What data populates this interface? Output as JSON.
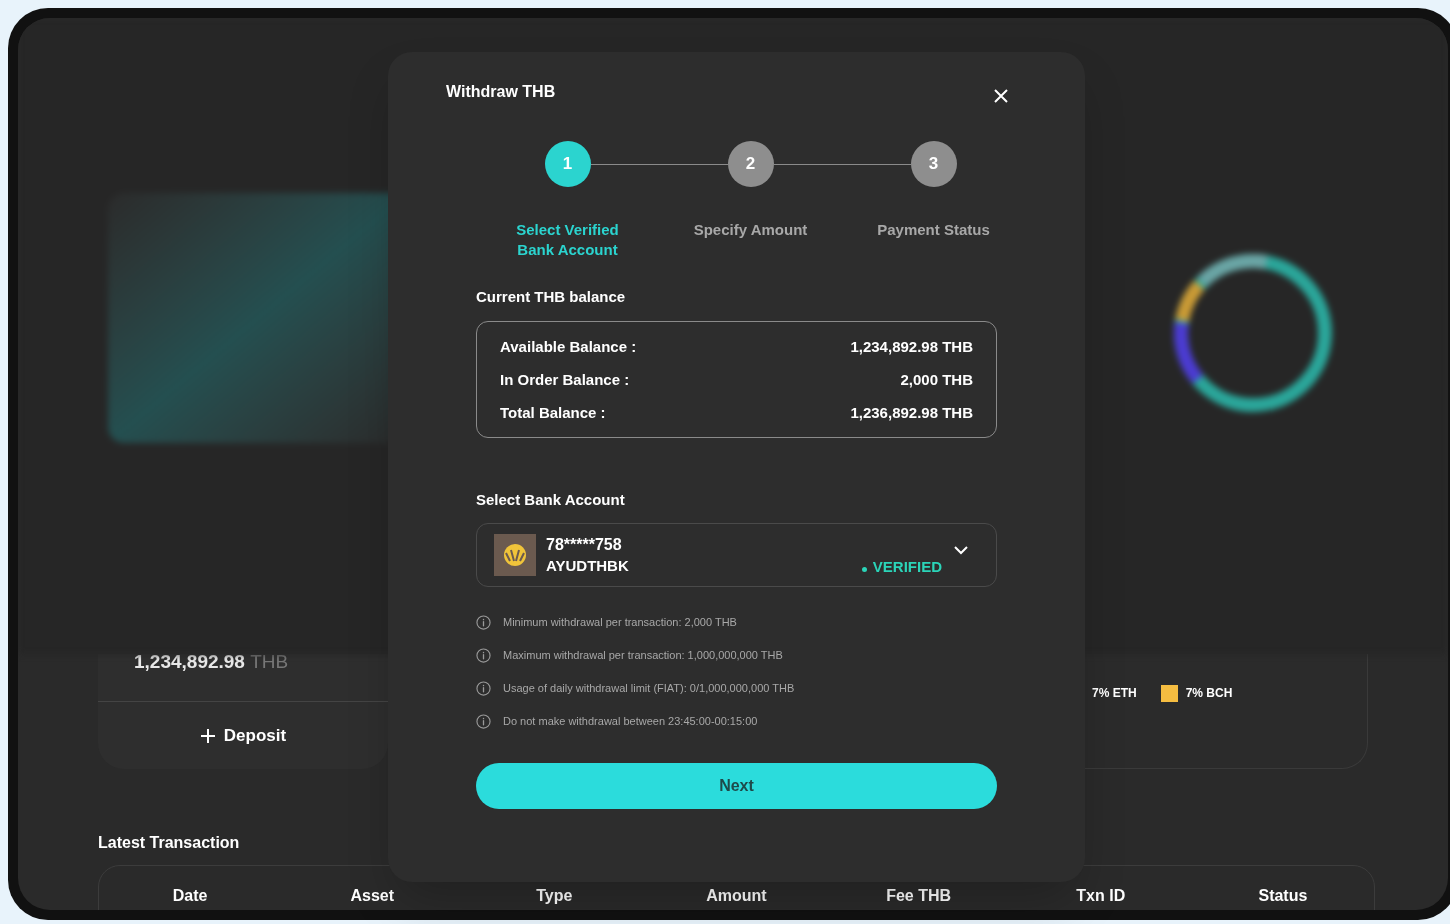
{
  "background": {
    "wallet": {
      "balance": "1,234,892.98",
      "currency": "THB",
      "deposit": "Deposit"
    },
    "legend": [
      {
        "label": "7% ETH"
      },
      {
        "label": "7% BCH",
        "color": "#f5bd41"
      }
    ],
    "latest_transaction": {
      "title": "Latest Transaction",
      "columns": [
        "Date",
        "Asset",
        "Type",
        "Amount",
        "Fee THB",
        "Txn ID",
        "Status"
      ]
    }
  },
  "modal": {
    "title": "Withdraw THB",
    "steps": [
      {
        "number": "1",
        "label": "Select Verified Bank Account",
        "selected": true
      },
      {
        "number": "2",
        "label": "Specify Amount",
        "selected": false
      },
      {
        "number": "3",
        "label": "Payment Status",
        "selected": false
      }
    ],
    "balance_title": "Current THB balance",
    "balances": [
      {
        "label": "Available Balance :",
        "value": "1,234,892.98 THB"
      },
      {
        "label": "In Order Balance :",
        "value": "2,000 THB"
      },
      {
        "label": "Total Balance :",
        "value": "1,236,892.98 THB"
      }
    ],
    "bank_title": "Select Bank Account",
    "bank": {
      "account": "78*****758",
      "code": "AYUDTHBK",
      "status": "VERIFIED",
      "verified": true
    },
    "notes": [
      "Minimum withdrawal per transaction: 2,000 THB",
      "Maximum withdrawal per transaction: 1,000,000,000 THB",
      "Usage of daily withdrawal limit (FIAT): 0/1,000,000,000 THB",
      "Do not make withdrawal between 23:45:00-00:15:00"
    ],
    "next": "Next"
  }
}
